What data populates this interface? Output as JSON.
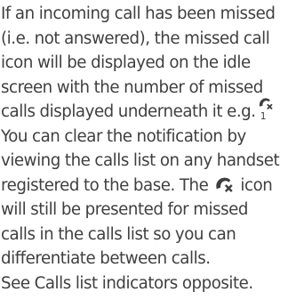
{
  "document": {
    "lines": [
      "If an incoming call has been missed",
      "(i.e. not answered), the missed call",
      "icon will be displayed on the idle",
      "screen with the number of missed",
      "calls displayed underneath it e.g.",
      "You can clear the notification by",
      "viewing the calls list on any handset",
      "registered to the base. The",
      "icon",
      "will still be presented for missed",
      "calls in the calls list so you can",
      "differentiate between calls.",
      "See Calls list indicators opposite."
    ],
    "example_icon": {
      "icon": "missed-call-icon",
      "count": "1"
    },
    "inline_icon": {
      "icon": "missed-call-icon"
    },
    "colors": {
      "text": "#3f3f3f"
    }
  }
}
